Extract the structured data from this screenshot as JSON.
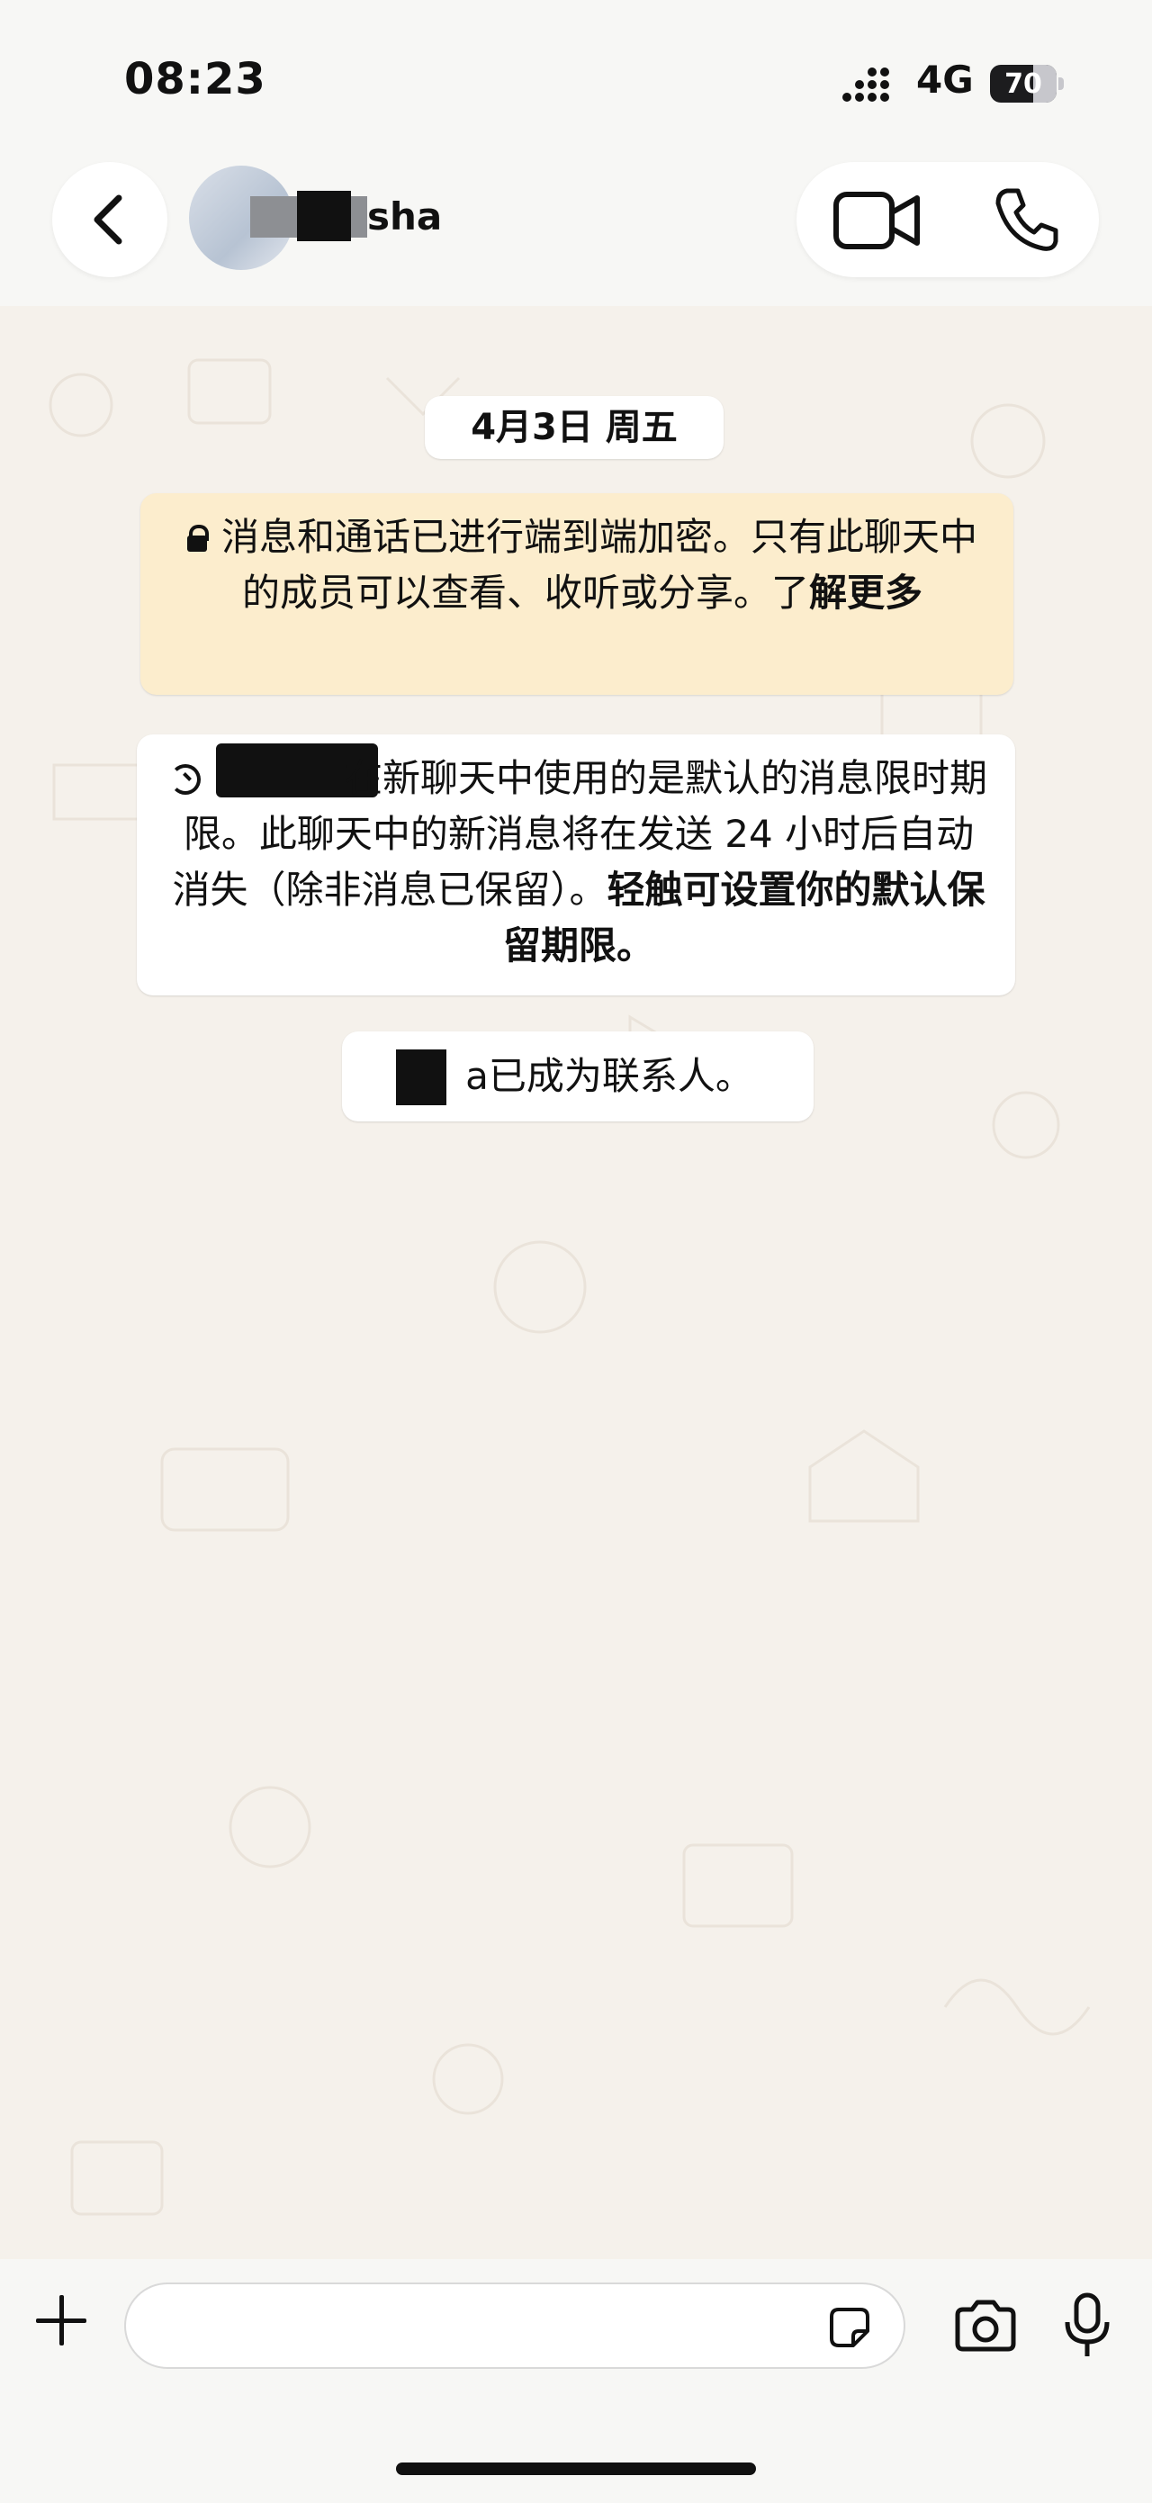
{
  "status_bar": {
    "time": "08:23",
    "network": "4G",
    "battery": "70"
  },
  "header": {
    "contact_name_suffix": "sha"
  },
  "date_chip": "4月3日 周五",
  "encryption_notice": {
    "text": "消息和通话已进行端到端加密。只有此聊天中的成员可以查看、收听或分享。了",
    "link": "解更多"
  },
  "disappearing_notice": {
    "text": "在新聊天中使用的是默认的消息限时期限。此聊天中的新消息将在发送 24 小时后自动消失（除非消息已保留）。",
    "link": "轻触可设置你的默认保留期限。"
  },
  "contact_notice": {
    "suffix": "a已成为联系人。"
  },
  "composer": {
    "placeholder": ""
  },
  "icons": [
    "back-arrow",
    "video-call",
    "phone-call",
    "lock",
    "timer",
    "plus",
    "sticker",
    "camera",
    "microphone"
  ]
}
